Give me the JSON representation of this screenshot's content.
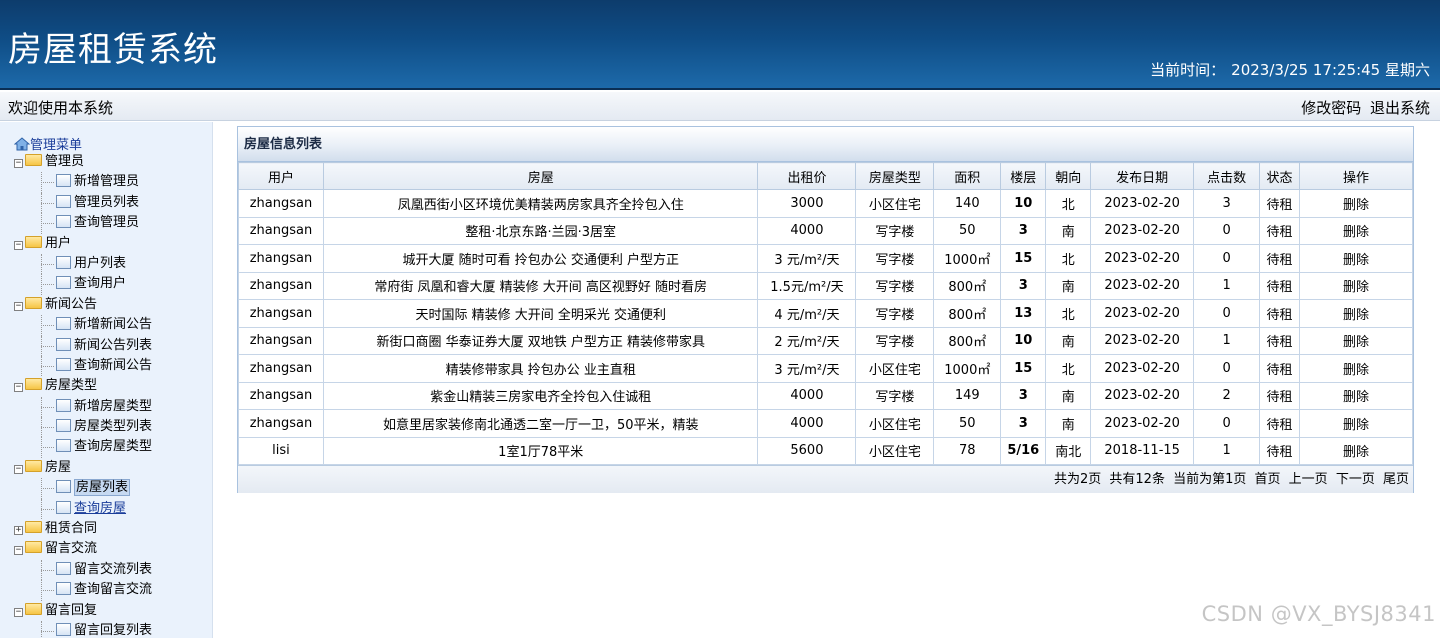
{
  "header": {
    "title": "房屋租赁系统",
    "time_label": "当前时间：",
    "time_value": "2023/3/25 17:25:45 星期六"
  },
  "welcome": {
    "message": "欢迎使用本系统",
    "change_password": "修改密码",
    "logout": "退出系统"
  },
  "sidebar": {
    "root": "管理菜单",
    "groups": [
      {
        "label": "管理员",
        "items": [
          "新增管理员",
          "管理员列表",
          "查询管理员"
        ]
      },
      {
        "label": "用户",
        "items": [
          "用户列表",
          "查询用户"
        ]
      },
      {
        "label": "新闻公告",
        "items": [
          "新增新闻公告",
          "新闻公告列表",
          "查询新闻公告"
        ]
      },
      {
        "label": "房屋类型",
        "items": [
          "新增房屋类型",
          "房屋类型列表",
          "查询房屋类型"
        ]
      },
      {
        "label": "房屋",
        "items": [
          "房屋列表",
          "查询房屋"
        ]
      },
      {
        "label": "租赁合同",
        "items": []
      },
      {
        "label": "留言交流",
        "items": [
          "留言交流列表",
          "查询留言交流"
        ]
      },
      {
        "label": "留言回复",
        "items": [
          "留言回复列表"
        ]
      }
    ]
  },
  "main": {
    "panel_title": "房屋信息列表",
    "columns": [
      "用户",
      "房屋",
      "出租价",
      "房屋类型",
      "面积",
      "楼层",
      "朝向",
      "发布日期",
      "点击数",
      "状态",
      "操作"
    ],
    "rows": [
      [
        "zhangsan",
        "凤凰西街小区环境优美精装两房家具齐全拎包入住",
        "3000",
        "小区住宅",
        "140",
        "10",
        "北",
        "2023-02-20",
        "3",
        "待租",
        "删除"
      ],
      [
        "zhangsan",
        "整租·北京东路·兰园·3居室",
        "4000",
        "写字楼",
        "50",
        "3",
        "南",
        "2023-02-20",
        "0",
        "待租",
        "删除"
      ],
      [
        "zhangsan",
        "城开大厦 随时可看 拎包办公 交通便利 户型方正",
        "3 元/m²/天",
        "写字楼",
        "1000㎡",
        "15",
        "北",
        "2023-02-20",
        "0",
        "待租",
        "删除"
      ],
      [
        "zhangsan",
        "常府街 凤凰和睿大厦 精装修 大开间 高区视野好 随时看房",
        "1.5元/m²/天",
        "写字楼",
        "800㎡",
        "3",
        "南",
        "2023-02-20",
        "1",
        "待租",
        "删除"
      ],
      [
        "zhangsan",
        "天时国际 精装修 大开间 全明采光 交通便利",
        "4 元/m²/天",
        "写字楼",
        "800㎡",
        "13",
        "北",
        "2023-02-20",
        "0",
        "待租",
        "删除"
      ],
      [
        "zhangsan",
        "新街口商圈 华泰证券大厦 双地铁 户型方正 精装修带家具",
        "2 元/m²/天",
        "写字楼",
        "800㎡",
        "10",
        "南",
        "2023-02-20",
        "1",
        "待租",
        "删除"
      ],
      [
        "zhangsan",
        "精装修带家具 拎包办公 业主直租",
        "3 元/m²/天",
        "小区住宅",
        "1000㎡",
        "15",
        "北",
        "2023-02-20",
        "0",
        "待租",
        "删除"
      ],
      [
        "zhangsan",
        "紫金山精装三房家电齐全拎包入住诚租",
        "4000",
        "写字楼",
        "149",
        "3",
        "南",
        "2023-02-20",
        "2",
        "待租",
        "删除"
      ],
      [
        "zhangsan",
        "如意里居家装修南北通透二室一厅一卫，50平米，精装",
        "4000",
        "小区住宅",
        "50",
        "3",
        "南",
        "2023-02-20",
        "0",
        "待租",
        "删除"
      ],
      [
        "lisi",
        "1室1厅78平米",
        "5600",
        "小区住宅",
        "78",
        "5/16",
        "南北",
        "2018-11-15",
        "1",
        "待租",
        "删除"
      ]
    ],
    "pager": {
      "total_pages": "共为2页",
      "total_items": "共有12条",
      "current": "当前为第1页",
      "first": "首页",
      "prev": "上一页",
      "next": "下一页",
      "last": "尾页"
    }
  },
  "watermark": "CSDN @VX_BYSJ8341"
}
